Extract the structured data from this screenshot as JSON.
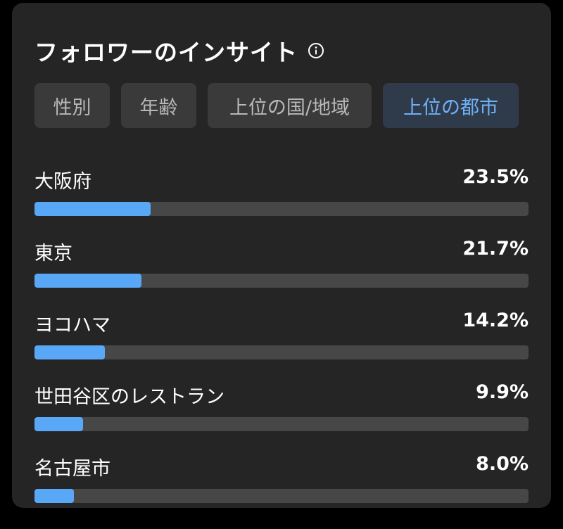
{
  "header": {
    "title": "フォロワーのインサイト",
    "info_icon": "info-circle-icon"
  },
  "tabs": [
    {
      "label": "性別",
      "active": false
    },
    {
      "label": "年齢",
      "active": false
    },
    {
      "label": "上位の国/地域",
      "active": false
    },
    {
      "label": "上位の都市",
      "active": true
    }
  ],
  "cities": [
    {
      "name": "大阪府",
      "percent_text": "23.5%",
      "percent": 23.5
    },
    {
      "name": "東京",
      "percent_text": "21.7%",
      "percent": 21.7
    },
    {
      "name": "ヨコハマ",
      "percent_text": "14.2%",
      "percent": 14.2
    },
    {
      "name": "世田谷区のレストラン",
      "percent_text": "9.9%",
      "percent": 9.9
    },
    {
      "name": "名古屋市",
      "percent_text": "8.0%",
      "percent": 8.0
    }
  ],
  "colors": {
    "card_background": "#252525",
    "bar_fill": "#59a8f7",
    "bar_track": "#474747",
    "active_tab_text": "#6fb1f5",
    "active_tab_background": "#2f3b4b"
  }
}
